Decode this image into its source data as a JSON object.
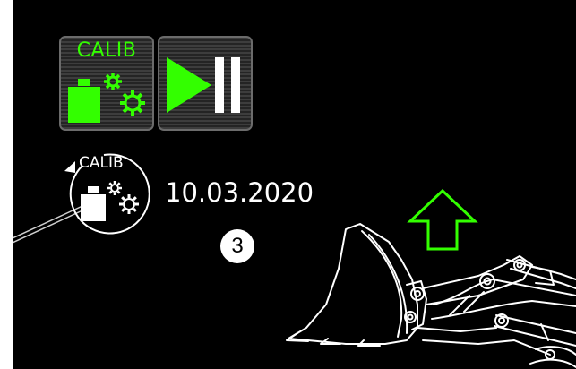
{
  "toolbar": {
    "calib_label": "CALIB",
    "calib_icon": "calibration-weight-gears-icon",
    "play_pause_icon": "play-pause-icon"
  },
  "calibration_status": {
    "icon_label": "CALIB",
    "icon": "calibration-history-icon",
    "date": "10.03.2020",
    "callout_number": "3"
  },
  "indicator": {
    "icon": "up-arrow-icon"
  },
  "illustration": {
    "icon": "wheel-loader-bucket-icon"
  },
  "colors": {
    "background": "#000000",
    "accent": "#33ff00",
    "text": "#ffffff",
    "tile_border": "#6b6b6b"
  }
}
